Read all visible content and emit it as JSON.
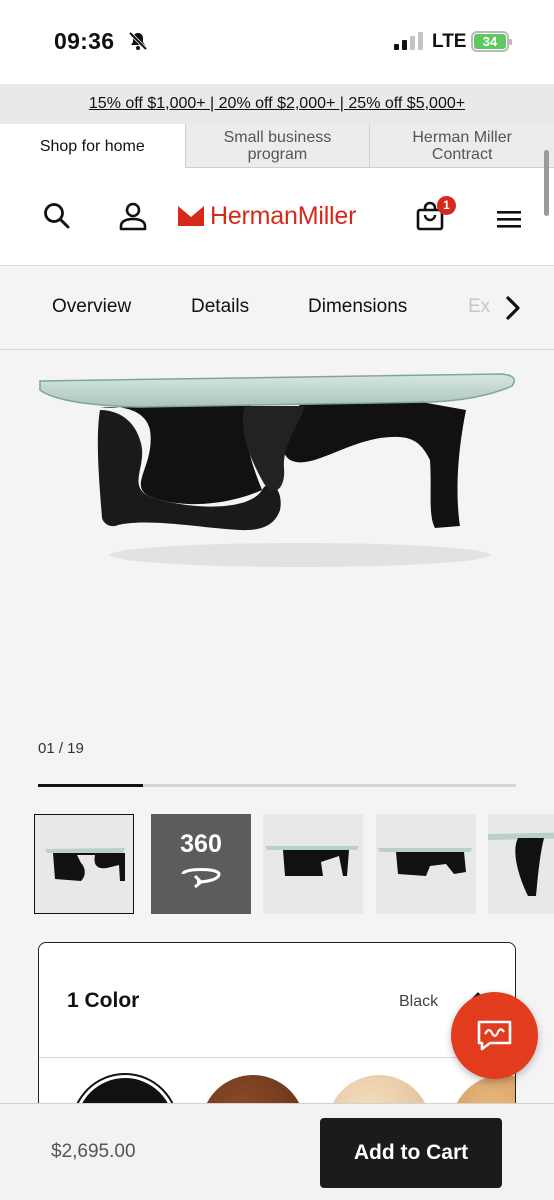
{
  "status_bar": {
    "time": "09:36",
    "network": "LTE",
    "battery": "34"
  },
  "promo": {
    "text": "15% off $1,000+ | 20% off $2,000+ | 25% off $5,000+"
  },
  "audience_tabs": [
    {
      "label": "Shop for home",
      "active": true
    },
    {
      "label": "Small business program",
      "active": false
    },
    {
      "label": "Herman Miller Contract",
      "active": false
    }
  ],
  "header": {
    "logo_text": "HermanMiller",
    "cart_count": "1",
    "brand_color": "#d6291b"
  },
  "section_tabs": [
    {
      "label": "Overview"
    },
    {
      "label": "Details"
    },
    {
      "label": "Dimensions"
    },
    {
      "label": "Ex"
    }
  ],
  "gallery": {
    "counter": "01 / 19",
    "progress_fraction": 0.22,
    "thumb_360_label": "360"
  },
  "options": {
    "title": "1 Color",
    "selected": "Black"
  },
  "footer": {
    "price": "$2,695.00",
    "add_to_cart": "Add to Cart"
  },
  "icons": [
    "bell-slash-icon",
    "search-icon",
    "account-icon",
    "cart-icon",
    "menu-icon",
    "chevron-right-icon",
    "chat-icon",
    "rotate-icon",
    "chevron-up-icon"
  ]
}
